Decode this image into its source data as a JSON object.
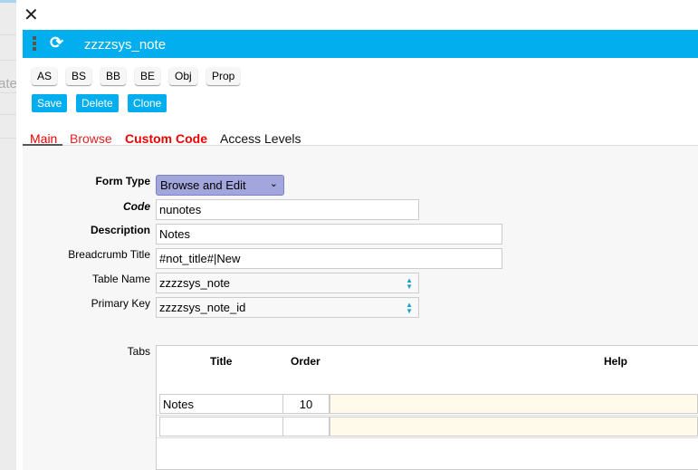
{
  "background": {
    "ghost_text": "ate"
  },
  "header": {
    "title": "zzzzsys_note",
    "color": "#02aeee"
  },
  "code_buttons": [
    "AS",
    "BS",
    "BB",
    "BE",
    "Obj",
    "Prop"
  ],
  "actions": {
    "save": "Save",
    "delete": "Delete",
    "clone": "Clone"
  },
  "tabs": [
    {
      "label": "Main",
      "selected": true
    },
    {
      "label": "Browse"
    },
    {
      "label": "Custom Code"
    },
    {
      "label": "Access Levels"
    }
  ],
  "form": {
    "form_type": {
      "label": "Form Type",
      "value": "Browse and Edit"
    },
    "code": {
      "label": "Code",
      "value": "nunotes"
    },
    "description": {
      "label": "Description",
      "value": "Notes"
    },
    "breadcrumb_title": {
      "label": "Breadcrumb Title",
      "value": "#not_title#|New"
    },
    "table_name": {
      "label": "Table Name",
      "value": "zzzzsys_note"
    },
    "primary_key": {
      "label": "Primary Key",
      "value": "zzzzsys_note_id"
    }
  },
  "tabs_grid": {
    "label": "Tabs",
    "columns": [
      "Title",
      "Order",
      "Help"
    ],
    "rows": [
      {
        "title": "Notes",
        "order": "10",
        "help": ""
      },
      {
        "title": "",
        "order": "",
        "help": ""
      }
    ]
  }
}
